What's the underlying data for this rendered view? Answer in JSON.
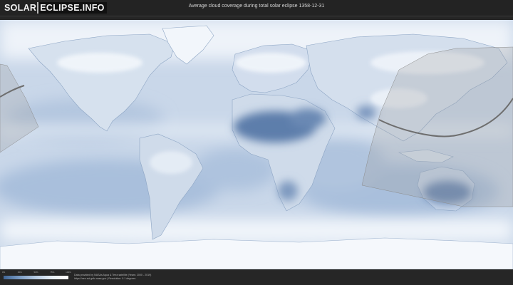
{
  "header": {
    "logo_part1": "SOLAR",
    "logo_part2": "ECLIPSE.INFO",
    "title": "Average cloud coverage during total solar eclipse 1358-12-31"
  },
  "legend": {
    "ticks": [
      "0%",
      "25%",
      "50%",
      "75%",
      "100%"
    ],
    "colors": [
      "#3f6596",
      "#7c9cc4",
      "#b7cbe2",
      "#e9f0f7",
      "#ffffff"
    ]
  },
  "credits": {
    "line1": "Data provided by NASAs Aqua & Terra satellite (Years: 2000 - 2019)",
    "line2": "https://neo.sci.gsfc.nasa.gov | Resolution: 0.1 degrees"
  },
  "map": {
    "ocean_color": "#c9d7e9",
    "cloud_color": "#f4f8fc",
    "clear_sky_color": "#5d7eab",
    "eclipse_zone_color": "#9e9e9e",
    "eclipse_path_color": "#6e6e6e"
  }
}
